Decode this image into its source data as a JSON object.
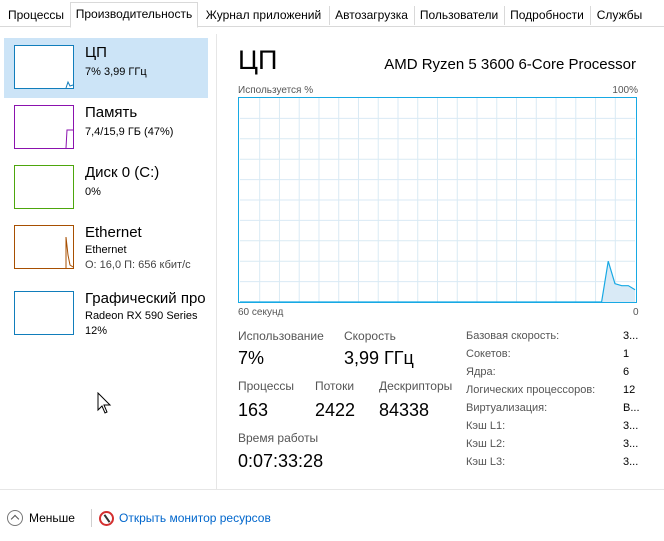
{
  "tabs": [
    {
      "label": "Процессы"
    },
    {
      "label": "Производительность"
    },
    {
      "label": "Журнал приложений"
    },
    {
      "label": "Автозагрузка"
    },
    {
      "label": "Пользователи"
    },
    {
      "label": "Подробности"
    },
    {
      "label": "Службы"
    }
  ],
  "active_tab": "Производительность",
  "resources": [
    {
      "title": "ЦП",
      "line1": "7%  3,99 ГГц",
      "line2": "",
      "color": "#117dbb"
    },
    {
      "title": "Память",
      "line1": "7,4/15,9 ГБ (47%)",
      "line2": "",
      "color": "#8b12ae"
    },
    {
      "title": "Диск 0 (C:)",
      "line1": "0%",
      "line2": "",
      "color": "#4da60c"
    },
    {
      "title": "Ethernet",
      "line1": "Ethernet",
      "line2": "О: 16,0 П: 656 кбит/с",
      "color": "#a74f01"
    },
    {
      "title": "Графический про",
      "line1": "Radeon RX 590 Series",
      "line2": "12%",
      "color": "#117dbb"
    }
  ],
  "main": {
    "title": "ЦП",
    "model": "AMD Ryzen 5 3600 6-Core Processor",
    "chart_top_left": "Используется %",
    "chart_top_right": "100%",
    "chart_bottom_left": "60 секунд",
    "chart_bottom_right": "0",
    "accent": "#17a9e4",
    "usage_series": [
      0,
      0,
      0,
      0,
      0,
      0,
      0,
      0,
      0,
      0,
      0,
      0,
      0,
      0,
      0,
      0,
      0,
      0,
      0,
      0,
      0,
      0,
      0,
      0,
      0,
      0,
      0,
      0,
      0,
      0,
      0,
      0,
      0,
      0,
      0,
      0,
      0,
      0,
      0,
      0,
      0,
      0,
      0,
      0,
      0,
      0,
      0,
      0,
      0,
      0,
      0,
      0,
      0,
      0,
      0,
      20,
      9,
      8,
      8,
      6
    ]
  },
  "stats": {
    "usage_label": "Использование",
    "usage_value": "7%",
    "speed_label": "Скорость",
    "speed_value": "3,99 ГГц",
    "processes_label": "Процессы",
    "processes_value": "163",
    "threads_label": "Потоки",
    "threads_value": "2422",
    "handles_label": "Дескрипторы",
    "handles_value": "84338",
    "uptime_label": "Время работы",
    "uptime_value": "0:07:33:28"
  },
  "specs": [
    {
      "label": "Базовая скорость:",
      "value": "3..."
    },
    {
      "label": "Сокетов:",
      "value": "1"
    },
    {
      "label": "Ядра:",
      "value": "6"
    },
    {
      "label": "Логических процессоров:",
      "value": "12"
    },
    {
      "label": "Виртуализация:",
      "value": "В..."
    },
    {
      "label": "Кэш L1:",
      "value": "3..."
    },
    {
      "label": "Кэш L2:",
      "value": "3..."
    },
    {
      "label": "Кэш L3:",
      "value": "3..."
    }
  ],
  "footer": {
    "less_label": "Меньше",
    "monitor_label": "Открыть монитор ресурсов"
  }
}
